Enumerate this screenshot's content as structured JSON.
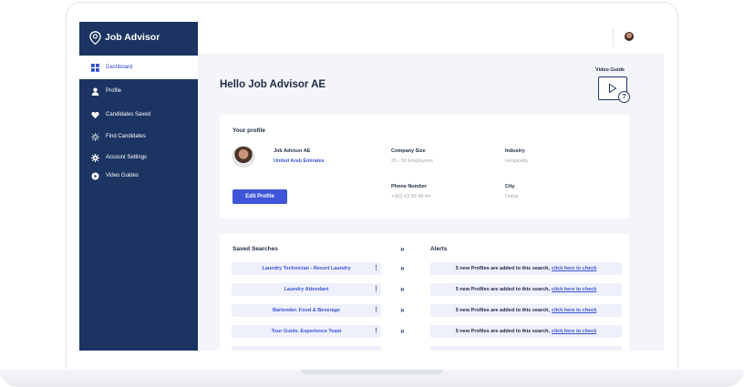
{
  "app": {
    "name": "Job Advisor"
  },
  "sidebar": {
    "items": [
      {
        "label": "Dashboard",
        "icon": "dashboard-icon"
      },
      {
        "label": "Profile",
        "icon": "user-icon"
      },
      {
        "label": "Candidates Saved",
        "icon": "heart-icon"
      },
      {
        "label": "Find Candidates",
        "icon": "crosshair-icon"
      },
      {
        "label": "Account Settings",
        "icon": "gear-icon"
      },
      {
        "label": "Video Guides",
        "icon": "video-icon"
      }
    ]
  },
  "header": {
    "greeting": "Hello Job Advisor AE"
  },
  "video_guide": {
    "label": "Video Guide",
    "help": "?"
  },
  "profile": {
    "title": "Your profile",
    "name": "Job Advisor AE",
    "country": "United Arab Emirates",
    "company_size_label": "Company Size",
    "company_size": "25 - 50 Employees",
    "industry_label": "Industry",
    "industry": "Hospitality",
    "phone_label": "Phone Number",
    "phone": "+363 43 55 48 44",
    "city_label": "City",
    "city": "Dubai",
    "edit_button": "Edit Profile"
  },
  "saved": {
    "title": "Saved Searches",
    "alerts_title": "Alerts",
    "arrow": "»",
    "rows": [
      {
        "search": "Laundry Technician - Resort Laundry",
        "alert": "5 new Profiles are added to this search,",
        "link": "click here to check"
      },
      {
        "search": "Laundry Attendant",
        "alert": "5 new Profiles are added to this search,",
        "link": "click here to check"
      },
      {
        "search": "Bartender. Food & Beverage",
        "alert": "5 new Profiles are added to this search,",
        "link": "click here to check"
      },
      {
        "search": "Tour Guide. Experience Team",
        "alert": "5 new Profiles are added to this search,",
        "link": "click here to check"
      }
    ]
  },
  "colors": {
    "sidebar": "#1c3462",
    "accent": "#3d55d6",
    "background": "#f4f5f9"
  }
}
